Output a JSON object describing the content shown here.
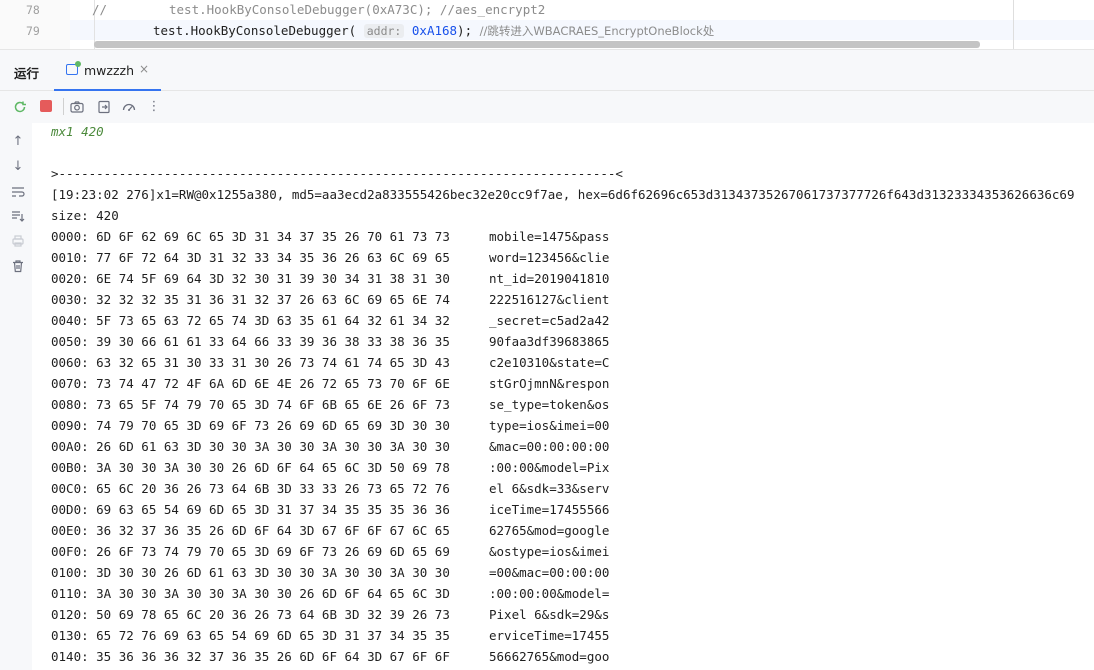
{
  "editor": {
    "lines": [
      {
        "num": "78",
        "prefix": "//",
        "code": "test.HookByConsoleDebugger(0xA73C); //aes_encrypt2"
      },
      {
        "num": "79",
        "code_pre": "test.HookByConsoleDebugger(",
        "hint": "addr:",
        "arg": "0xA168",
        "code_post": ");",
        "comment": "//跳转进入WBACRAES_EncryptOneBlock处"
      }
    ]
  },
  "run_panel": {
    "label": "运行",
    "tab_label": "mwzzzh",
    "tab_close": "×"
  },
  "toolbar": {
    "icons": [
      "rerun-icon",
      "stop-icon",
      "screenshot-icon",
      "restore-layout-icon",
      "profiler-icon",
      "more-icon"
    ],
    "more_label": "⋮"
  },
  "console": {
    "header": "mx1 420",
    "separator": ">--------------------------------------------------------------------------<",
    "info_line": "[19:23:02 276]x1=RW@0x1255a380, md5=aa3ecd2a833555426bec32e20cc9f7ae, hex=6d6f62696c653d31343735267061737377726f643d31323334353626636c69",
    "size_line": "size: 420",
    "rows": [
      {
        "addr": "0000:",
        "hex": "6D 6F 62 69 6C 65 3D 31 34 37 35 26 70 61 73 73",
        "ascii": "mobile=1475&pass"
      },
      {
        "addr": "0010:",
        "hex": "77 6F 72 64 3D 31 32 33 34 35 36 26 63 6C 69 65",
        "ascii": "word=123456&clie"
      },
      {
        "addr": "0020:",
        "hex": "6E 74 5F 69 64 3D 32 30 31 39 30 34 31 38 31 30",
        "ascii": "nt_id=2019041810"
      },
      {
        "addr": "0030:",
        "hex": "32 32 32 35 31 36 31 32 37 26 63 6C 69 65 6E 74",
        "ascii": "222516127&client"
      },
      {
        "addr": "0040:",
        "hex": "5F 73 65 63 72 65 74 3D 63 35 61 64 32 61 34 32",
        "ascii": "_secret=c5ad2a42"
      },
      {
        "addr": "0050:",
        "hex": "39 30 66 61 61 33 64 66 33 39 36 38 33 38 36 35",
        "ascii": "90faa3df39683865"
      },
      {
        "addr": "0060:",
        "hex": "63 32 65 31 30 33 31 30 26 73 74 61 74 65 3D 43",
        "ascii": "c2e10310&state=C"
      },
      {
        "addr": "0070:",
        "hex": "73 74 47 72 4F 6A 6D 6E 4E 26 72 65 73 70 6F 6E",
        "ascii": "stGrOjmnN&respon"
      },
      {
        "addr": "0080:",
        "hex": "73 65 5F 74 79 70 65 3D 74 6F 6B 65 6E 26 6F 73",
        "ascii": "se_type=token&os"
      },
      {
        "addr": "0090:",
        "hex": "74 79 70 65 3D 69 6F 73 26 69 6D 65 69 3D 30 30",
        "ascii": "type=ios&imei=00"
      },
      {
        "addr": "00A0:",
        "hex": "26 6D 61 63 3D 30 30 3A 30 30 3A 30 30 3A 30 30",
        "ascii": "&mac=00:00:00:00"
      },
      {
        "addr": "00B0:",
        "hex": "3A 30 30 3A 30 30 26 6D 6F 64 65 6C 3D 50 69 78",
        "ascii": ":00:00&model=Pix"
      },
      {
        "addr": "00C0:",
        "hex": "65 6C 20 36 26 73 64 6B 3D 33 33 26 73 65 72 76",
        "ascii": "el 6&sdk=33&serv"
      },
      {
        "addr": "00D0:",
        "hex": "69 63 65 54 69 6D 65 3D 31 37 34 35 35 35 36 36",
        "ascii": "iceTime=17455566"
      },
      {
        "addr": "00E0:",
        "hex": "36 32 37 36 35 26 6D 6F 64 3D 67 6F 6F 67 6C 65",
        "ascii": "62765&mod=google"
      },
      {
        "addr": "00F0:",
        "hex": "26 6F 73 74 79 70 65 3D 69 6F 73 26 69 6D 65 69",
        "ascii": "&ostype=ios&imei"
      },
      {
        "addr": "0100:",
        "hex": "3D 30 30 26 6D 61 63 3D 30 30 3A 30 30 3A 30 30",
        "ascii": "=00&mac=00:00:00"
      },
      {
        "addr": "0110:",
        "hex": "3A 30 30 3A 30 30 3A 30 30 26 6D 6F 64 65 6C 3D",
        "ascii": ":00:00:00&model="
      },
      {
        "addr": "0120:",
        "hex": "50 69 78 65 6C 20 36 26 73 64 6B 3D 32 39 26 73",
        "ascii": "Pixel 6&sdk=29&s"
      },
      {
        "addr": "0130:",
        "hex": "65 72 76 69 63 65 54 69 6D 65 3D 31 37 34 35 35",
        "ascii": "erviceTime=17455"
      },
      {
        "addr": "0140:",
        "hex": "35 36 36 36 32 37 36 35 26 6D 6F 64 3D 67 6F 6F",
        "ascii": "56662765&mod=goo"
      }
    ]
  },
  "colors": {
    "accent": "#3574f0",
    "stop": "#e55b5b",
    "comment": "#8c8c8c",
    "number": "#1750eb",
    "italic_output": "#4c8a3c"
  }
}
